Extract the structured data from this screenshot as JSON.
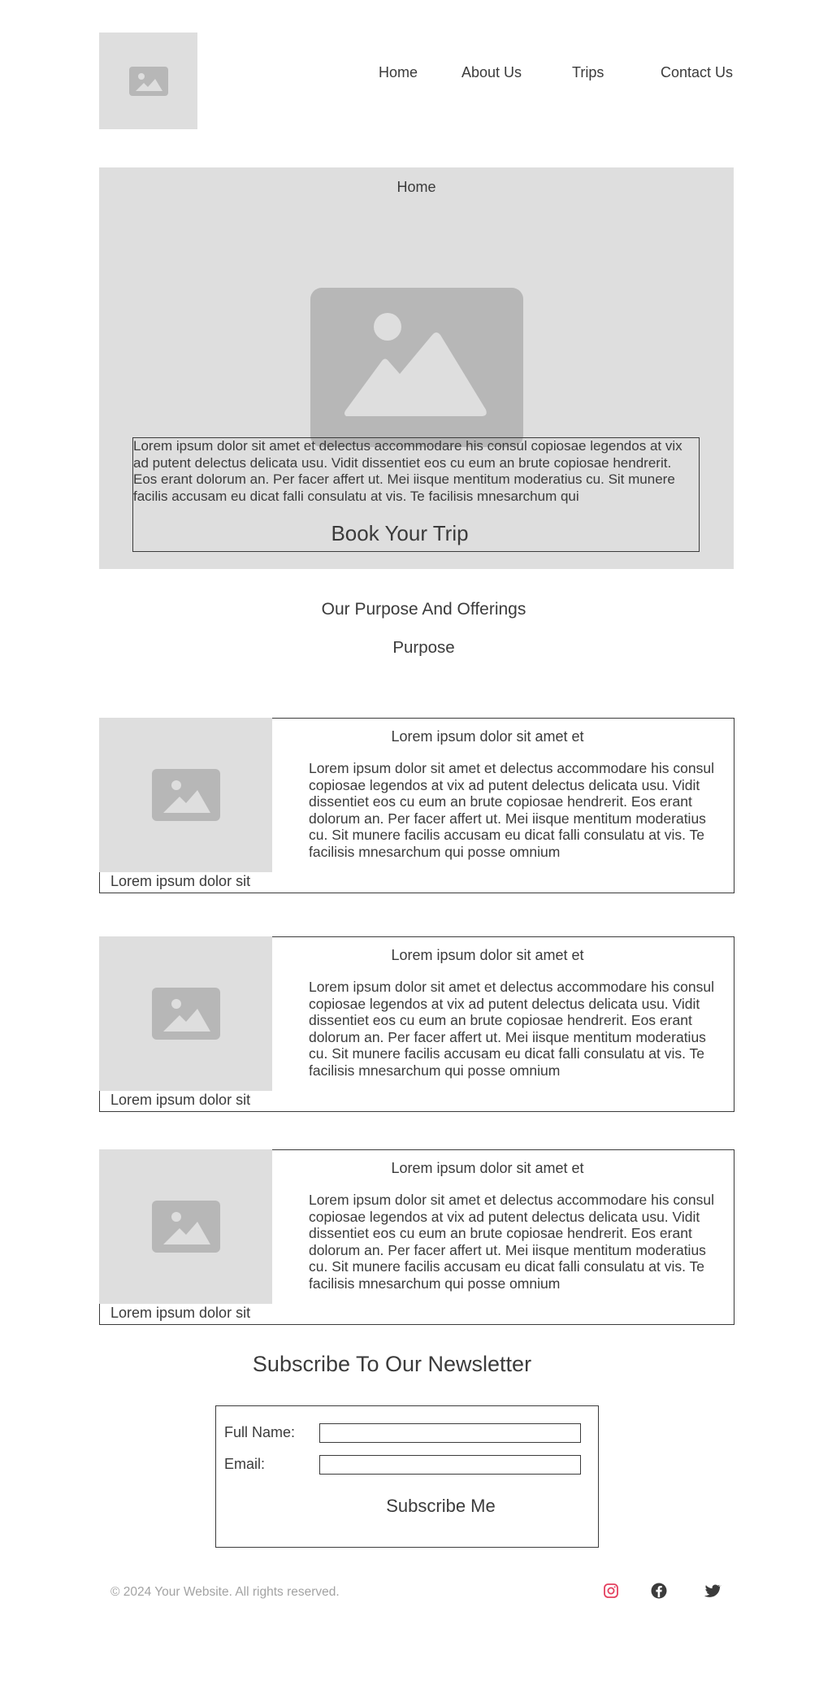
{
  "header": {
    "logo": "image-placeholder-icon",
    "nav": [
      {
        "label": "Home"
      },
      {
        "label": "About Us"
      },
      {
        "label": "Trips"
      },
      {
        "label": "Contact Us"
      }
    ]
  },
  "hero": {
    "title": "Home",
    "image": "image-placeholder-icon",
    "text": "Lorem ipsum dolor sit amet et delectus accommodare his consul copiosae legendos at vix ad putent delectus delicata usu. Vidit dissentiet eos cu eum an brute copiosae hendrerit. Eos erant dolorum an. Per facer affert ut. Mei iisque mentitum moderatius cu. Sit munere facilis accusam eu dicat falli consulatu at vis. Te facilisis mnesarchum qui",
    "cta_label": "Book Your Trip"
  },
  "offerings": {
    "title": "Our Purpose And Offerings",
    "subtitle": "Purpose"
  },
  "cards": [
    {
      "heading": "Lorem ipsum dolor sit amet et",
      "body": "Lorem ipsum dolor sit amet et delectus accommodare his consul copiosae legendos at vix ad putent delectus delicata usu. Vidit dissentiet eos cu eum an brute copiosae hendrerit. Eos erant dolorum an. Per facer affert ut. Mei iisque mentitum moderatius cu. Sit munere facilis accusam eu dicat falli consulatu at vis. Te facilisis mnesarchum qui posse omnium",
      "caption": "Lorem ipsum dolor sit"
    },
    {
      "heading": "Lorem ipsum dolor sit amet et",
      "body": "Lorem ipsum dolor sit amet et delectus accommodare his consul copiosae legendos at vix ad putent delectus delicata usu. Vidit dissentiet eos cu eum an brute copiosae hendrerit. Eos erant dolorum an. Per facer affert ut. Mei iisque mentitum moderatius cu. Sit munere facilis accusam eu dicat falli consulatu at vis. Te facilisis mnesarchum qui posse omnium",
      "caption": "Lorem ipsum dolor sit"
    },
    {
      "heading": "Lorem ipsum dolor sit amet et",
      "body": "Lorem ipsum dolor sit amet et delectus accommodare his consul copiosae legendos at vix ad putent delectus delicata usu. Vidit dissentiet eos cu eum an brute copiosae hendrerit. Eos erant dolorum an. Per facer affert ut. Mei iisque mentitum moderatius cu. Sit munere facilis accusam eu dicat falli consulatu at vis. Te facilisis mnesarchum qui posse omnium",
      "caption": "Lorem ipsum dolor sit"
    }
  ],
  "newsletter": {
    "title": "Subscribe To Our Newsletter",
    "fullname_label": "Full Name:",
    "fullname_value": "",
    "email_label": "Email:",
    "email_value": "",
    "submit_label": "Subscribe Me"
  },
  "footer": {
    "copyright": "© 2024 Your Website. All rights reserved.",
    "social": [
      {
        "icon": "instagram-icon",
        "color": "#e4405f"
      },
      {
        "icon": "facebook-icon",
        "color": "#3b3b3b"
      },
      {
        "icon": "twitter-icon",
        "color": "#3b3b3b"
      }
    ]
  },
  "colors": {
    "placeholder_bg": "#dedede",
    "placeholder_icon": "#b7b7b7",
    "text": "#3b3b3b",
    "muted": "#a3a3a3"
  }
}
